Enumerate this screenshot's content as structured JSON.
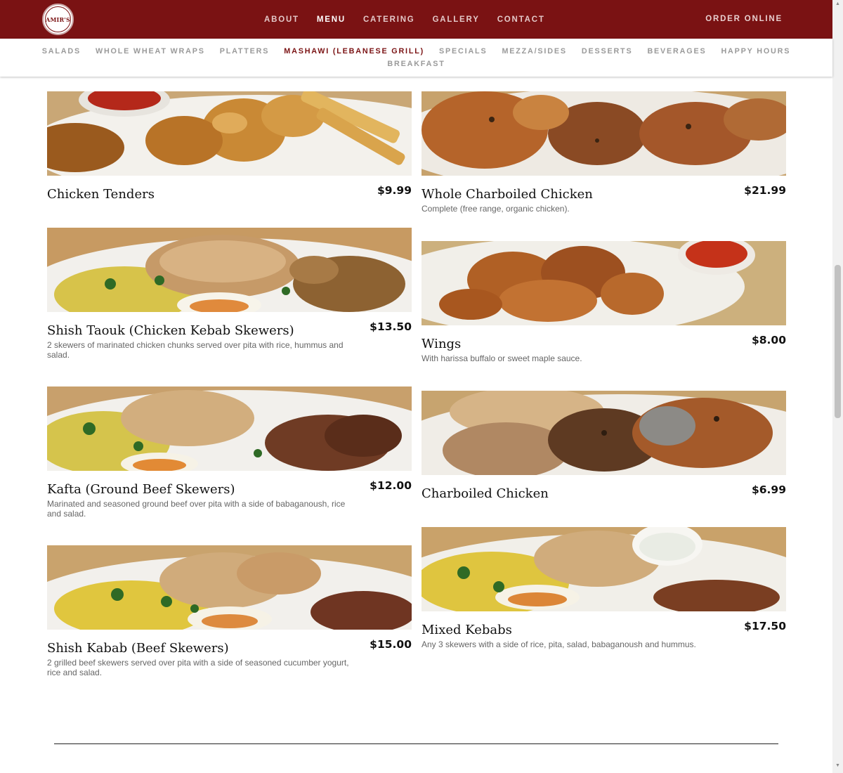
{
  "brand": {
    "logo_text": "AMIR'S"
  },
  "main_nav": {
    "items": [
      {
        "label": "ABOUT",
        "active": false
      },
      {
        "label": "MENU",
        "active": true
      },
      {
        "label": "CATERING",
        "active": false
      },
      {
        "label": "GALLERY",
        "active": false
      },
      {
        "label": "CONTACT",
        "active": false
      }
    ],
    "order_online": "ORDER ONLINE"
  },
  "category_nav": {
    "row1": [
      {
        "label": "SALADS",
        "active": false
      },
      {
        "label": "WHOLE WHEAT WRAPS",
        "active": false
      },
      {
        "label": "PLATTERS",
        "active": false
      },
      {
        "label": "MASHAWI (LEBANESE GRILL)",
        "active": true
      },
      {
        "label": "SPECIALS",
        "active": false
      },
      {
        "label": "MEZZA/SIDES",
        "active": false
      },
      {
        "label": "DESSERTS",
        "active": false
      },
      {
        "label": "BEVERAGES",
        "active": false
      },
      {
        "label": "HAPPY HOURS",
        "active": false
      }
    ],
    "row2": [
      {
        "label": "BREAKFAST",
        "active": false
      }
    ]
  },
  "menu_items": [
    {
      "name": "Chicken Tenders",
      "price": "$9.99",
      "description": "",
      "photo": "fried-chicken-tenders-photo"
    },
    {
      "name": "Whole Charboiled Chicken",
      "price": "$21.99",
      "description": "Complete (free range, organic chicken).",
      "photo": "whole-chicken-photo"
    },
    {
      "name": "Shish Taouk (Chicken Kebab Skewers)",
      "price": "$13.50",
      "description": "2 skewers of marinated chicken chunks served over pita with rice, hummus and salad.",
      "photo": "chicken-kebab-plate-photo"
    },
    {
      "name": "Wings",
      "price": "$8.00",
      "description": "With harissa buffalo or sweet maple sauce.",
      "photo": "wings-photo"
    },
    {
      "name": "Kafta (Ground Beef Skewers)",
      "price": "$12.00",
      "description": "Marinated and seasoned ground beef over pita with a side of babaganoush, rice and salad.",
      "photo": "kafta-plate-photo"
    },
    {
      "name": "Charboiled Chicken",
      "price": "$6.99",
      "description": "",
      "photo": "charboiled-chicken-photo"
    },
    {
      "name": "Shish Kabab (Beef Skewers)",
      "price": "$15.00",
      "description": "2 grilled beef skewers served over pita with a side of seasoned cucumber yogurt, rice and salad.",
      "photo": "beef-kabab-plate-photo"
    },
    {
      "name": "Mixed Kebabs",
      "price": "$17.50",
      "description": "Any 3 skewers with a side of rice, pita, salad, babaganoush and hummus.",
      "photo": "mixed-kebabs-plate-photo"
    }
  ],
  "colors": {
    "brand_red": "#7a1213",
    "nav_inactive": "#9a9a9a",
    "description_gray": "#666666"
  }
}
